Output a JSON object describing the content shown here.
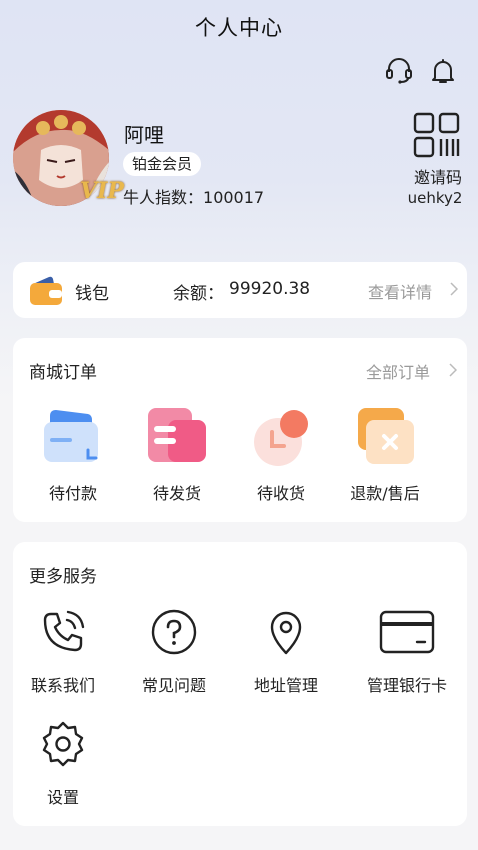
{
  "header": {
    "title": "个人中心"
  },
  "profile": {
    "name": "阿哩",
    "member_level": "铂金会员",
    "index_label": "牛人指数：",
    "index_value": "100017",
    "vip_badge": "VIP"
  },
  "invite": {
    "label": "邀请码",
    "code": "uehky2"
  },
  "wallet": {
    "label": "钱包",
    "balance_label": "余额：",
    "balance_value": "99920.38",
    "detail_link": "查看详情"
  },
  "orders": {
    "title": "商城订单",
    "all_link": "全部订单",
    "items": [
      {
        "label": "待付款",
        "icon": "pending-payment-icon"
      },
      {
        "label": "待发货",
        "icon": "pending-shipment-icon"
      },
      {
        "label": "待收货",
        "icon": "pending-receipt-icon"
      },
      {
        "label": "退款/售后",
        "icon": "refund-icon"
      }
    ]
  },
  "services": {
    "title": "更多服务",
    "items": [
      {
        "label": "联系我们",
        "icon": "phone-icon"
      },
      {
        "label": "常见问题",
        "icon": "question-icon"
      },
      {
        "label": "地址管理",
        "icon": "location-pin-icon"
      },
      {
        "label": "管理银行卡",
        "icon": "bank-card-icon"
      },
      {
        "label": "设置",
        "icon": "gear-icon"
      }
    ]
  },
  "colors": {
    "header_gradient": "#dfe4f4",
    "wallet_orange": "#f4a93b",
    "muted_text": "#9a9a9a"
  }
}
